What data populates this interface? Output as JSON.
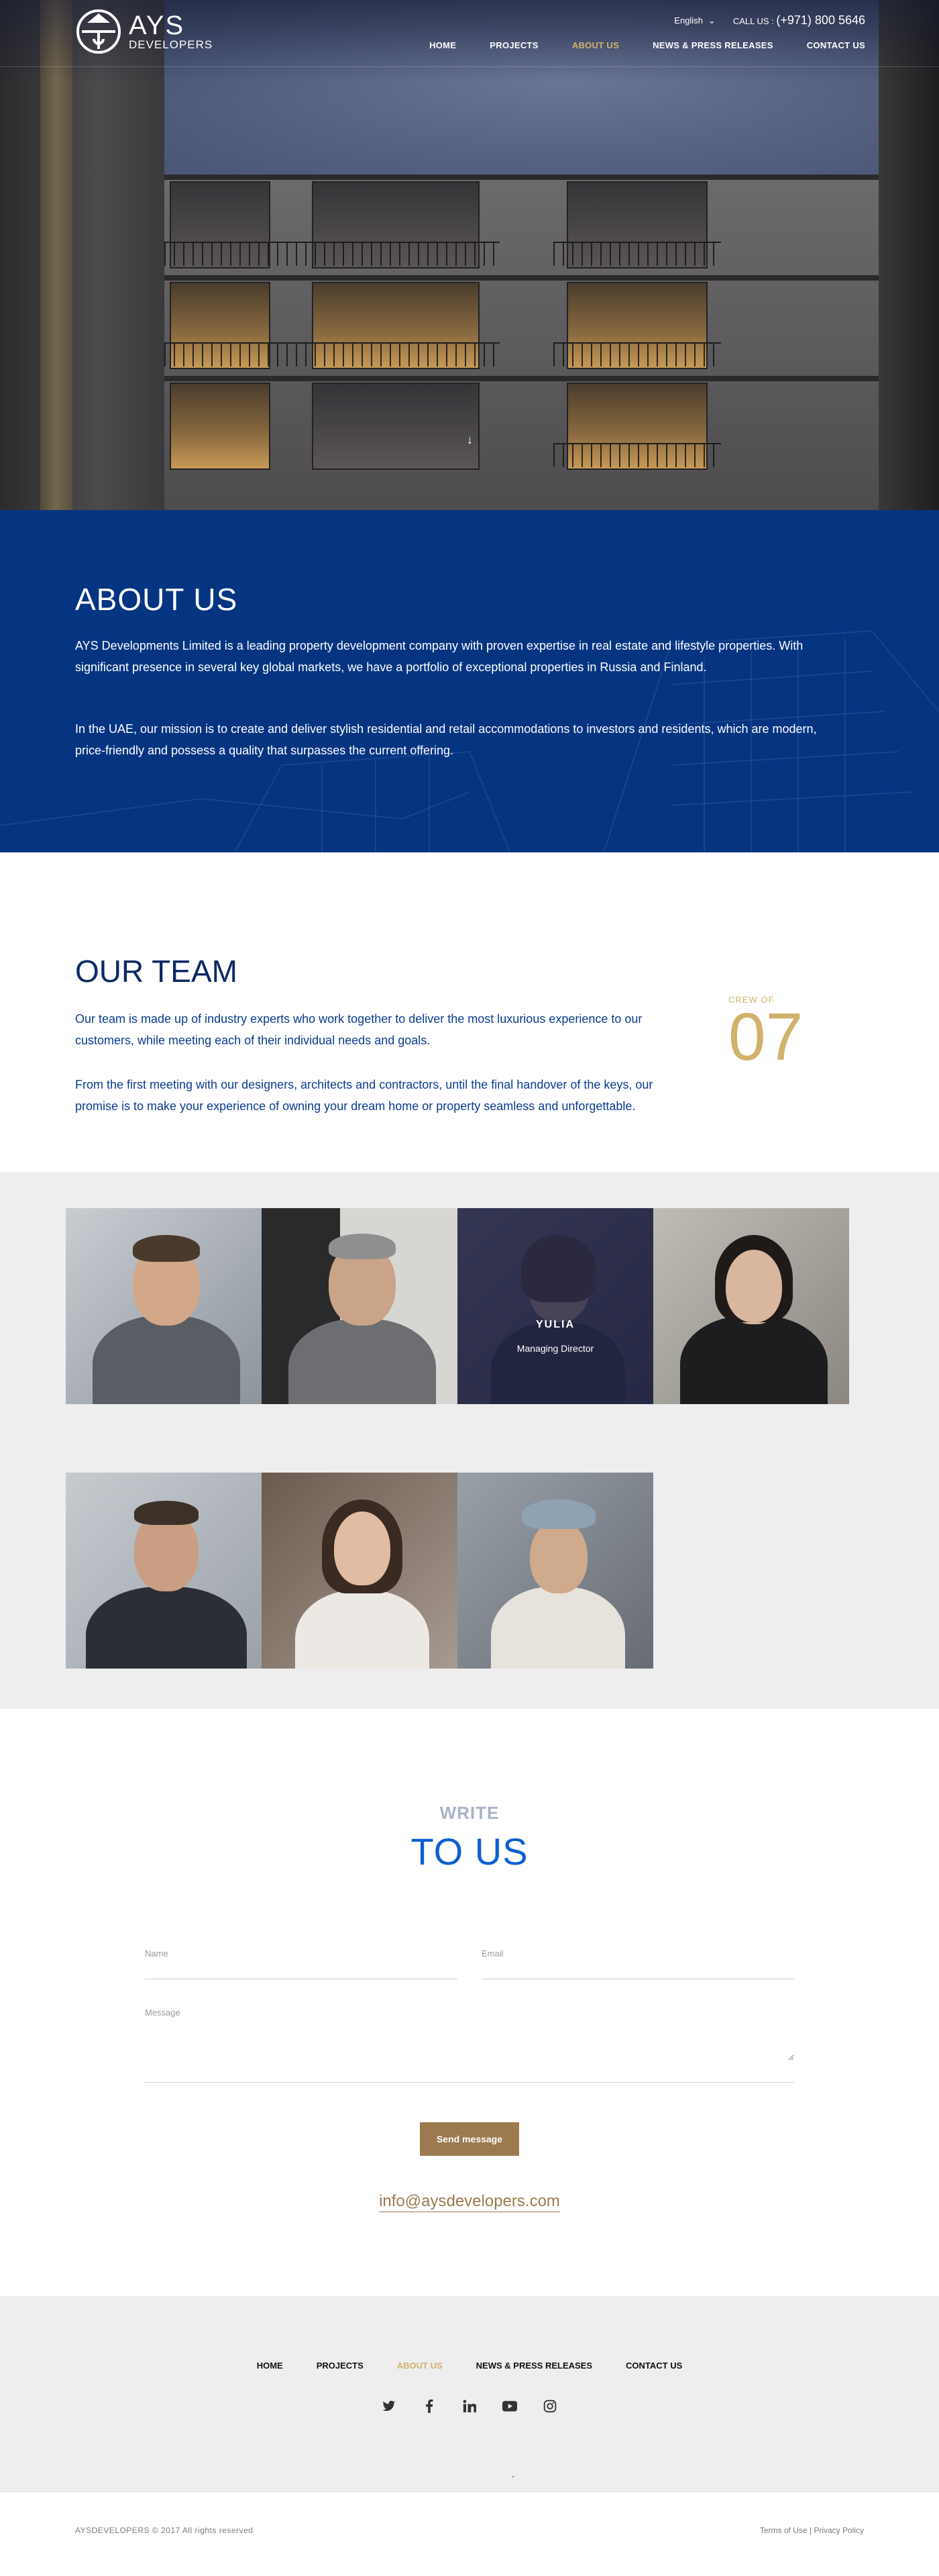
{
  "brand": {
    "name": "AYS",
    "sub": "DEVELOPERS"
  },
  "topbar": {
    "language": "English",
    "call_label": "CALL US :",
    "phone": "(+971) 800 5646"
  },
  "nav": [
    {
      "label": "HOME",
      "active": false
    },
    {
      "label": "PROJECTS",
      "active": false
    },
    {
      "label": "ABOUT US",
      "active": true
    },
    {
      "label": "NEWS & PRESS RELEASES",
      "active": false
    },
    {
      "label": "CONTACT US",
      "active": false
    }
  ],
  "about": {
    "title": "ABOUT US",
    "p1": "AYS Developments Limited is a leading property development company with proven expertise in real estate and lifestyle properties. With significant presence in several key global markets, we have a portfolio of exceptional properties in Russia and Finland.",
    "p2": "In the UAE, our mission is to create and deliver stylish residential and retail accommodations to investors and residents, which are modern, price-friendly and possess a quality that surpasses the current offering."
  },
  "team": {
    "title": "OUR TEAM",
    "p1": "Our team is made up of industry experts who work together to deliver the most luxurious experience to our customers, while meeting each of their individual needs and goals.",
    "p2": "From the first meeting with our designers, architects and contractors, until the final handover of the keys, our promise is to make your experience of owning your dream home or property seamless and unforgettable.",
    "crew_label": "CREW OF",
    "crew_count": "07",
    "featured_member": {
      "name": "YULIA",
      "role": "Managing Director"
    }
  },
  "write": {
    "line1": "WRITE",
    "line2": "TO US",
    "name_label": "Name",
    "email_label": "Email",
    "message_label": "Message",
    "send_label": "Send message",
    "email": "info@aysdevelopers.com"
  },
  "footer": {
    "nav": [
      "HOME",
      "PROJECTS",
      "ABOUT US",
      "NEWS & PRESS RELEASES",
      "CONTACT US"
    ],
    "social_icons": [
      "twitter-icon",
      "facebook-icon",
      "linkedin-icon",
      "youtube-icon",
      "instagram-icon"
    ],
    "copyright": "AYSDEVELOPERS © 2017 All rights reserved",
    "terms": "Terms of Use",
    "separator": "|",
    "privacy": "Privacy Policy"
  },
  "colors": {
    "navy": "#053581",
    "gold": "#d1b26c",
    "button": "#9b7a4f",
    "accent_blue": "#0b5fd1"
  }
}
